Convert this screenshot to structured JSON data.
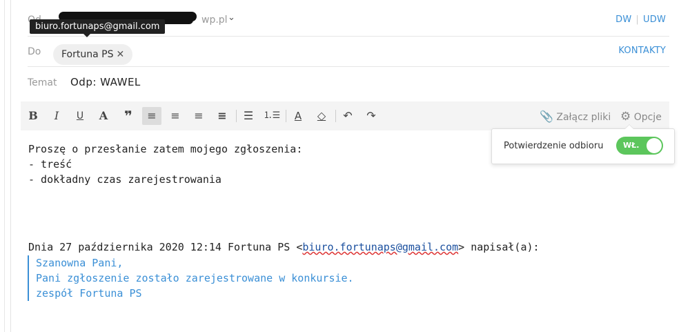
{
  "compose": {
    "from_label": "Od",
    "from_visible_suffix": "wp.pl",
    "from_tooltip": "biuro.fortunaps@gmail.com",
    "cc_label": "DW",
    "bcc_label": "UDW",
    "to_label": "Do",
    "to_chip": "Fortuna PS",
    "contacts_label": "KONTAKTY",
    "subject_label": "Temat",
    "subject_value": "Odp: WAWEL"
  },
  "toolbar": {
    "attach_label": "Załącz pliki",
    "options_label": "Opcje"
  },
  "options_popup": {
    "read_receipt_label": "Potwierdzenie odbioru",
    "toggle_label": "WŁ."
  },
  "message": {
    "line1": "Proszę o przesłanie zatem mojego zgłoszenia:",
    "line2": "- treść",
    "line3": "- dokładny czas zarejestrowania",
    "reply_prefix": "Dnia 27 października 2020 12:14 Fortuna PS <",
    "reply_email": "biuro.fortunaps@gmail.com",
    "reply_suffix": "> napisał(a):",
    "quote_line1": "Szanowna Pani,",
    "quote_line2": "Pani zgłoszenie zostało zarejestrowane w konkursie.",
    "quote_line3": "zespół Fortuna PS"
  }
}
